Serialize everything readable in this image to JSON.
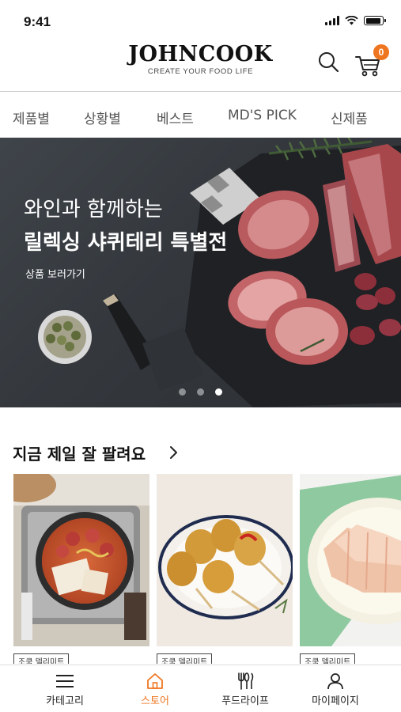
{
  "status_bar": {
    "time": "9:41",
    "battery_level": 0.9
  },
  "header": {
    "logo_title": "JOHNCOOK",
    "logo_subtitle": "CREATE YOUR FOOD LIFE",
    "search_icon": "search-icon",
    "cart_icon": "cart-icon",
    "cart_count": "0",
    "accent_color": "#ef7620"
  },
  "tabs": [
    {
      "label": "제품별"
    },
    {
      "label": "상황별"
    },
    {
      "label": "베스트"
    },
    {
      "label": "MD'S PICK"
    },
    {
      "label": "신제품"
    }
  ],
  "banner": {
    "line1": "와인과 함께하는",
    "line2": "릴렉싱 샤퀴테리 특별전",
    "link": "상품 보러가기",
    "slide_count": 3,
    "active_slide": 3
  },
  "best_section": {
    "title": "지금 제일 잘 팔려요",
    "arrow_icon": "chevron-right-icon",
    "products": [
      {
        "tag": "조쿡 델리미트",
        "image": "budae-jjigae-stew"
      },
      {
        "tag": "조쿡 델리미트",
        "image": "corn-dogs-plate"
      },
      {
        "tag": "조쿡 델리미트",
        "image": "sliced-ham-plate"
      }
    ]
  },
  "bottom_nav": [
    {
      "label": "카테고리",
      "icon": "menu-icon",
      "active": false
    },
    {
      "label": "스토어",
      "icon": "home-icon",
      "active": true
    },
    {
      "label": "푸드라이프",
      "icon": "utensils-icon",
      "active": false
    },
    {
      "label": "마이페이지",
      "icon": "user-icon",
      "active": false
    }
  ]
}
